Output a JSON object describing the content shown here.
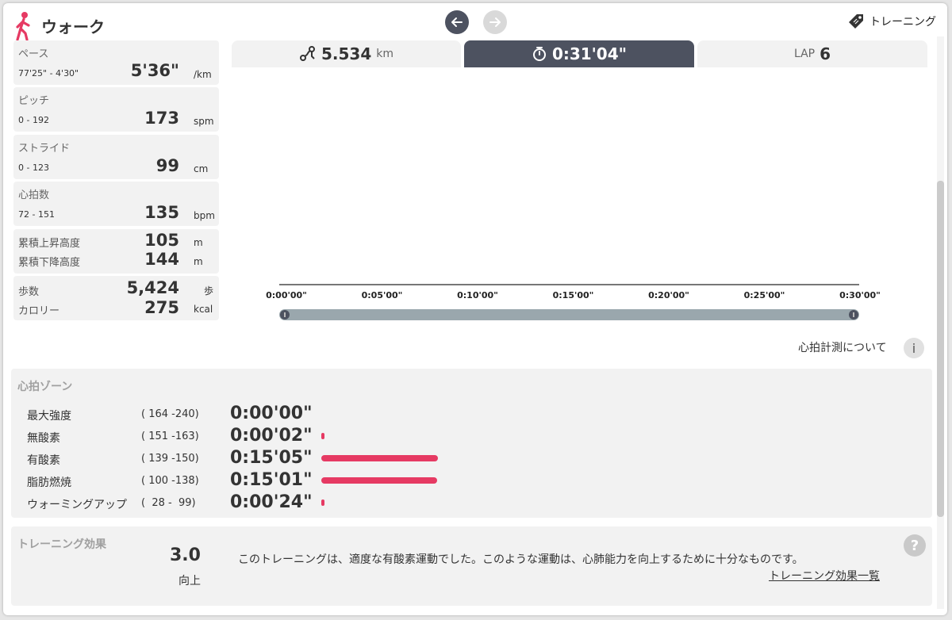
{
  "header": {
    "title": "ウォーク",
    "training_label": "トレーニング"
  },
  "metrics": {
    "pace": {
      "label": "ペース",
      "range": "77'25\" - 4'30\"",
      "value": "5'36\"",
      "unit": "/km"
    },
    "pitch": {
      "label": "ピッチ",
      "range": "0 - 192",
      "value": "173",
      "unit": "spm"
    },
    "stride": {
      "label": "ストライド",
      "range": "0 - 123",
      "value": "99",
      "unit": "cm"
    },
    "heart_rate": {
      "label": "心拍数",
      "range": "72 - 151",
      "value": "135",
      "unit": "bpm"
    },
    "elevation": {
      "ascent_label": "累積上昇高度",
      "ascent_value": "105",
      "ascent_unit": "m",
      "descent_label": "累積下降高度",
      "descent_value": "144",
      "descent_unit": "m"
    },
    "steps_cal": {
      "steps_label": "歩数",
      "steps_value": "5,424",
      "steps_unit": "歩",
      "cal_label": "カロリー",
      "cal_value": "275",
      "cal_unit": "kcal"
    }
  },
  "tabs": {
    "distance": {
      "value": "5.534",
      "unit": "km"
    },
    "time": {
      "value": "0:31'04\""
    },
    "lap": {
      "label": "LAP",
      "value": "6"
    }
  },
  "timeline": {
    "ticks": [
      "0:00'00\"",
      "0:05'00\"",
      "0:10'00\"",
      "0:15'00\"",
      "0:20'00\"",
      "0:25'00\"",
      "0:30'00\""
    ]
  },
  "hr_about": "心拍計測について",
  "zones": {
    "title": "心拍ゾーン",
    "max_minutes": 15.1,
    "items": [
      {
        "name": "最大強度",
        "range": "( 164 -240)",
        "time": "0:00'00\"",
        "minutes": 0
      },
      {
        "name": "無酸素",
        "range": "( 151 -163)",
        "time": "0:00'02\"",
        "minutes": 0.03
      },
      {
        "name": "有酸素",
        "range": "( 139 -150)",
        "time": "0:15'05\"",
        "minutes": 15.08
      },
      {
        "name": "脂肪燃焼",
        "range": "( 100 -138)",
        "time": "0:15'01\"",
        "minutes": 15.02
      },
      {
        "name": "ウォーミングアップ",
        "range": "(  28 -  99)",
        "time": "0:00'24\"",
        "minutes": 0.4
      }
    ]
  },
  "effect": {
    "title": "トレーニング効果",
    "score": "3.0",
    "level": "向上",
    "description": "このトレーニングは、適度な有酸素運動でした。このような運動は、心肺能力を向上するために十分なものです。",
    "link": "トレーニング効果一覧",
    "help": "?"
  },
  "colors": {
    "accent_pink": "#e63a63",
    "tab_active": "#4d5260",
    "panel_bg": "#f2f2f2"
  }
}
